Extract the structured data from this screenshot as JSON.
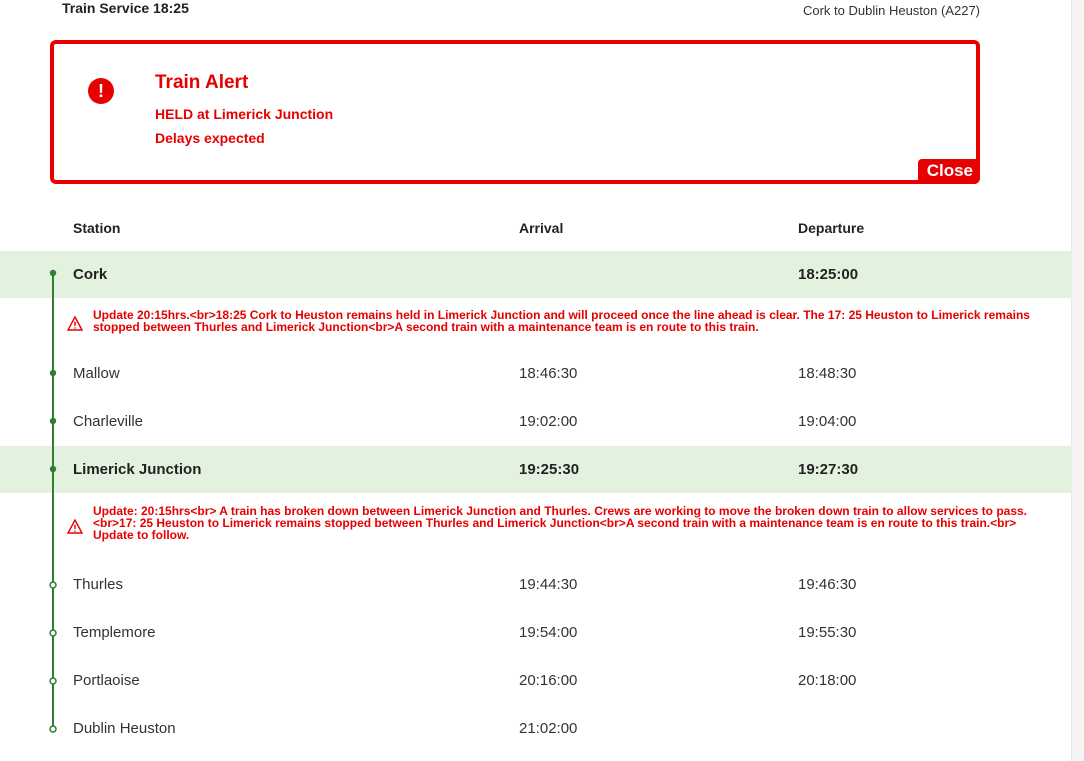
{
  "header": {
    "title": "Train Service 18:25",
    "route": "Cork to Dublin Heuston (A227)"
  },
  "alert": {
    "icon": "exclamation-icon",
    "title": "Train Alert",
    "line1": "HELD at Limerick Junction",
    "line2": "Delays expected",
    "close_label": "Close"
  },
  "columns": {
    "station": "Station",
    "arrival": "Arrival",
    "departure": "Departure"
  },
  "stops": [
    {
      "station": "Cork",
      "arrival": "",
      "departure": "18:25:00",
      "highlight": true,
      "passed": true
    },
    {
      "station": "Mallow",
      "arrival": "18:46:30",
      "departure": "18:48:30",
      "highlight": false,
      "passed": true
    },
    {
      "station": "Charleville",
      "arrival": "19:02:00",
      "departure": "19:04:00",
      "highlight": false,
      "passed": true
    },
    {
      "station": "Limerick Junction",
      "arrival": "19:25:30",
      "departure": "19:27:30",
      "highlight": true,
      "passed": true
    },
    {
      "station": "Thurles",
      "arrival": "19:44:30",
      "departure": "19:46:30",
      "highlight": false,
      "passed": false
    },
    {
      "station": "Templemore",
      "arrival": "19:54:00",
      "departure": "19:55:30",
      "highlight": false,
      "passed": false
    },
    {
      "station": "Portlaoise",
      "arrival": "20:16:00",
      "departure": "20:18:00",
      "highlight": false,
      "passed": false
    },
    {
      "station": "Dublin Heuston",
      "arrival": "21:02:00",
      "departure": "",
      "highlight": false,
      "passed": false
    }
  ],
  "notes": [
    {
      "icon": "warning-icon",
      "text": "Update 20:15hrs.<br>18:25 Cork to Heuston remains held in Limerick Junction and will proceed once the line ahead is clear. The 17: 25 Heuston to Limerick remains stopped between Thurles and Limerick Junction<br>A second train with a maintenance team is en route to this train."
    },
    {
      "icon": "warning-icon",
      "text": "Update: 20:15hrs<br> A train has broken down between Limerick Junction and Thurles. Crews are working to move the broken down train to allow services to pass.<br>17: 25 Heuston to Limerick remains stopped between Thurles and Limerick Junction<br>A second train with a maintenance team is en route to this train.<br> Update to follow."
    }
  ],
  "colors": {
    "alert_red": "#e60000",
    "track_green": "#2e7d32",
    "highlight_bg": "#e3f2de"
  }
}
